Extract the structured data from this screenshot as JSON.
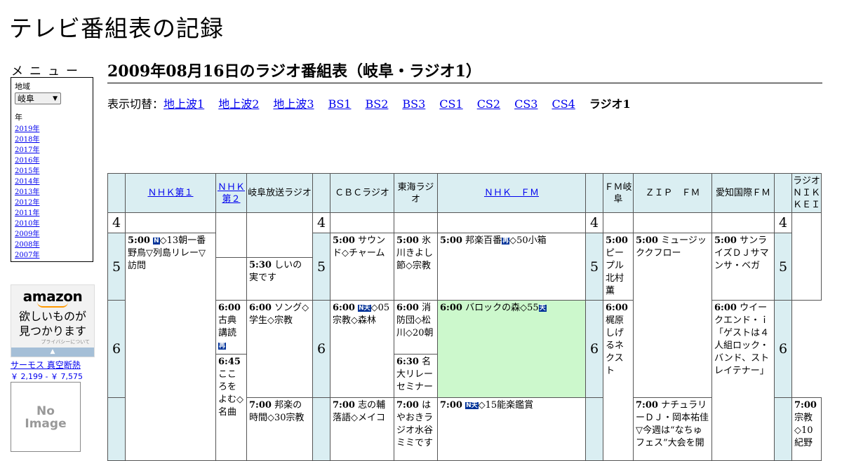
{
  "site": {
    "title": "テレビ番組表の記録"
  },
  "menu": {
    "heading": "メニュー",
    "region_label": "地域",
    "region_value": "岐阜",
    "year_label": "年",
    "years": [
      "2019年",
      "2018年",
      "2017年",
      "2016年",
      "2015年",
      "2014年",
      "2013年",
      "2012年",
      "2011年",
      "2010年",
      "2009年",
      "2008年",
      "2007年"
    ]
  },
  "ad": {
    "brand": "amazon",
    "tagline_1": "欲しいものが",
    "tagline_2": "見つかります",
    "privacy": "プライバシーについて",
    "product": "サーモス 真空断熱",
    "price": "￥ 2,199 - ￥ 7,575",
    "no_image_1": "No",
    "no_image_2": "Image"
  },
  "page": {
    "heading": "2009年08月16日のラジオ番組表（岐阜・ラジオ1）",
    "switch_label": "表示切替：",
    "switch_links": [
      "地上波1",
      "地上波2",
      "地上波3",
      "BS1",
      "BS2",
      "BS3",
      "CS1",
      "CS2",
      "CS3",
      "CS4"
    ],
    "switch_current": "ラジオ1"
  },
  "schedule": {
    "stations": [
      "ＮＨＫ第１",
      "ＮＨＫ第２",
      "岐阜放送ラジオ",
      "ＣＢＣラジオ",
      "東海ラジオ",
      "ＮＨＫ　ＦＭ",
      "ＦＭ岐阜",
      "ＺＩＰ　ＦＭ",
      "愛知国際ＦＭ",
      "ラジオＮＩＫＫＥＩ"
    ],
    "hours": [
      "4",
      "5",
      "6"
    ],
    "programs": {
      "nhk1_500": {
        "time": "5:00",
        "badge": "N",
        "title": "◇13朝一番野鳥▽列島リレー▽訪問"
      },
      "nhk2_600": {
        "time": "6:00",
        "title": "古典講読",
        "badge": "再"
      },
      "nhk2_645": {
        "time": "6:45",
        "title": "こころをよむ◇名曲"
      },
      "gifu_530": {
        "time": "5:30",
        "title": "しいの実です"
      },
      "gifu_600": {
        "time": "6:00",
        "title": "ソング◇学生◇宗教"
      },
      "gifu_700": {
        "time": "7:00",
        "title": "邦楽の時間◇30宗教"
      },
      "cbc_500": {
        "time": "5:00",
        "title": "サウンド◇チャーム"
      },
      "cbc_600": {
        "time": "6:00",
        "badge": "N天",
        "title": "◇05宗教◇森林"
      },
      "cbc_700": {
        "time": "7:00",
        "title": "志の輔落語◇メイコ"
      },
      "tokai_500": {
        "time": "5:00",
        "title": "氷川きよし節◇宗教"
      },
      "tokai_600": {
        "time": "6:00",
        "title": "消防団◇松川◇20朝"
      },
      "tokai_630": {
        "time": "6:30",
        "title": "名大リレーセミナー"
      },
      "tokai_700": {
        "time": "7:00",
        "title": "はやおきラジオ水谷ミミです"
      },
      "nhkfm_500": {
        "time": "5:00",
        "title": "邦楽百番",
        "badge": "再",
        "title2": "◇50小箱"
      },
      "nhkfm_600": {
        "time": "6:00",
        "title": "バロックの森◇55",
        "badge": "天"
      },
      "nhkfm_700": {
        "time": "7:00",
        "badge": "N天",
        "title": "◇15能楽鑑賞"
      },
      "fmgifu_500": {
        "time": "5:00",
        "title": "ピープル北村薫"
      },
      "fmgifu_600": {
        "time": "6:00",
        "title": "梶原しげるネクスト"
      },
      "zip_500": {
        "time": "5:00",
        "title": "ミュージッククフロー"
      },
      "zip_700": {
        "time": "7:00",
        "title": "ナチュラリーＤＪ・岡本祐佳▽今週は“なちゅフェス”大会を開"
      },
      "aichi_500": {
        "time": "5:00",
        "title": "サンライズＤＪサマンサ・ベガ"
      },
      "aichi_600": {
        "time": "6:00",
        "title": "ウイークエンド・ｉ「ゲストは４人組ロック・バンド、ストレイテナー」"
      },
      "nikkei_700": {
        "time": "7:00",
        "title": "宗教◇10紀野"
      }
    }
  },
  "colors": {
    "header_bg": "#daeef2",
    "highlight": "#ccf8cc",
    "link": "#0000ee",
    "badge": "#003399"
  }
}
